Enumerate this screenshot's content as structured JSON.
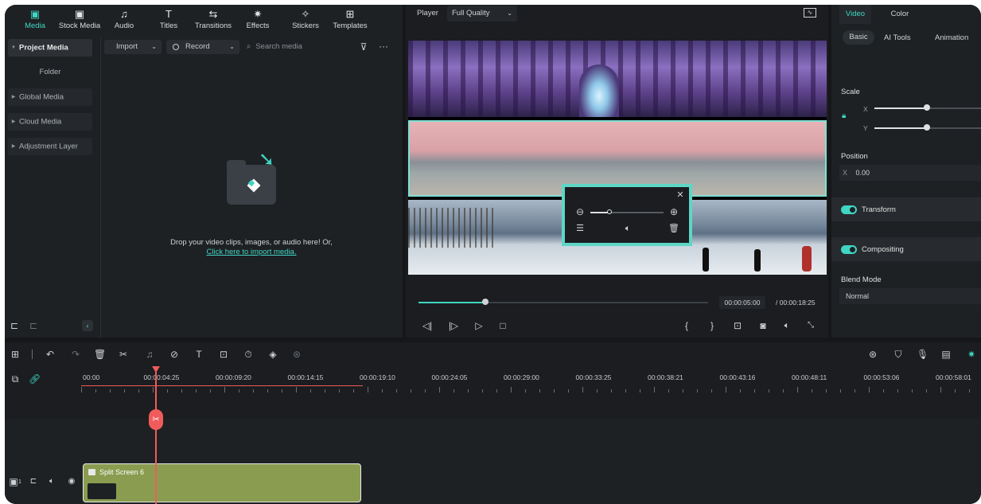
{
  "top_tabs": [
    {
      "label": "Media",
      "icon": "media-icon",
      "active": true
    },
    {
      "label": "Stock Media",
      "icon": "stock-media-icon"
    },
    {
      "label": "Audio",
      "icon": "music-note-icon"
    },
    {
      "label": "Titles",
      "icon": "text-t-icon"
    },
    {
      "label": "Transitions",
      "icon": "transition-arrows-icon"
    },
    {
      "label": "Effects",
      "icon": "sparkle-icon"
    },
    {
      "label": "Stickers",
      "icon": "sticker-icon"
    },
    {
      "label": "Templates",
      "icon": "template-grid-icon"
    }
  ],
  "sidebar": {
    "items": [
      {
        "label": "Project Media"
      },
      {
        "label": "Folder"
      },
      {
        "label": "Global Media"
      },
      {
        "label": "Cloud Media"
      },
      {
        "label": "Adjustment Layer"
      }
    ]
  },
  "media_toolbar": {
    "import_label": "Import",
    "record_label": "Record",
    "search_placeholder": "Search media"
  },
  "drop_zone": {
    "text": "Drop your video clips, images, or audio here! Or,",
    "link": "Click here to import media."
  },
  "player": {
    "label": "Player",
    "quality": "Full Quality",
    "current_time": "00:00:05:00",
    "total_time": "/ 00:00:18:25",
    "progress": 0.23
  },
  "right_panel": {
    "tabs": [
      "Video",
      "Color"
    ],
    "subtabs": [
      "Basic",
      "AI Tools",
      "Animation"
    ],
    "scale_label": "Scale",
    "x_label": "X",
    "y_label": "Y",
    "position_label": "Position",
    "position_x_label": "X",
    "position_x_value": "0.00",
    "transform_label": "Transform",
    "compositing_label": "Compositing",
    "blend_mode_label": "Blend Mode",
    "blend_mode_value": "Normal"
  },
  "timeline": {
    "ruler": [
      "00:00",
      "00:00:04:25",
      "00:00:09:20",
      "00:00:14:15",
      "00:00:19:10",
      "00:00:24:05",
      "00:00:29:00",
      "00:00:33:25",
      "00:00:38:21",
      "00:00:43:16",
      "00:00:48:11",
      "00:00:53:06",
      "00:00:58:01"
    ],
    "clip_label": "Split Screen 6",
    "track_number": "1"
  },
  "colors": {
    "accent": "#3fd6c3",
    "playhead": "#f15b5b",
    "clip": "#8a9c4f"
  }
}
